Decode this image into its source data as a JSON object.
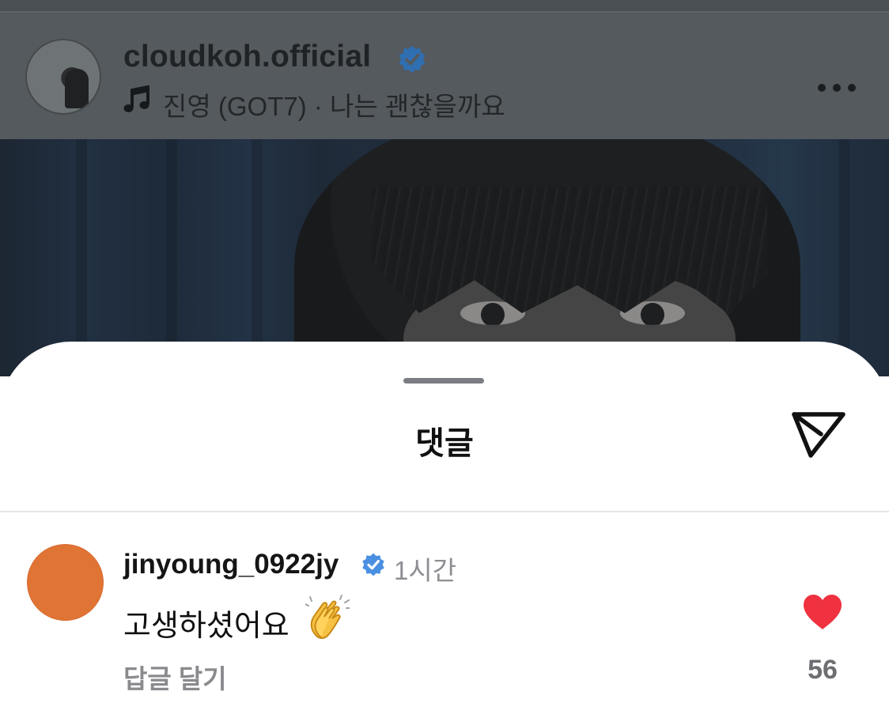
{
  "post": {
    "username": "cloudkoh.official",
    "song": "진영 (GOT7) · 나는 괜찮을까요",
    "icons": {
      "avatar": "profile-avatar",
      "verified": "verified-badge-icon",
      "music": "music-note-icon",
      "more": "more-horizontal-icon"
    }
  },
  "sheet": {
    "title": "댓글",
    "icons": {
      "share": "send-paper-plane-icon"
    }
  },
  "comments": [
    {
      "username": "jinyoung_0922jy",
      "time": "1시간",
      "text": "고생하셨어요",
      "emoji": "clapping-hands-icon",
      "reply_label": "답글 달기",
      "likes": "56",
      "liked": true
    }
  ],
  "colors": {
    "verified": "#4a90e2",
    "heart": "#ef3140",
    "comment_avatar": "#e07435",
    "secondary_text": "#8e8e93"
  }
}
